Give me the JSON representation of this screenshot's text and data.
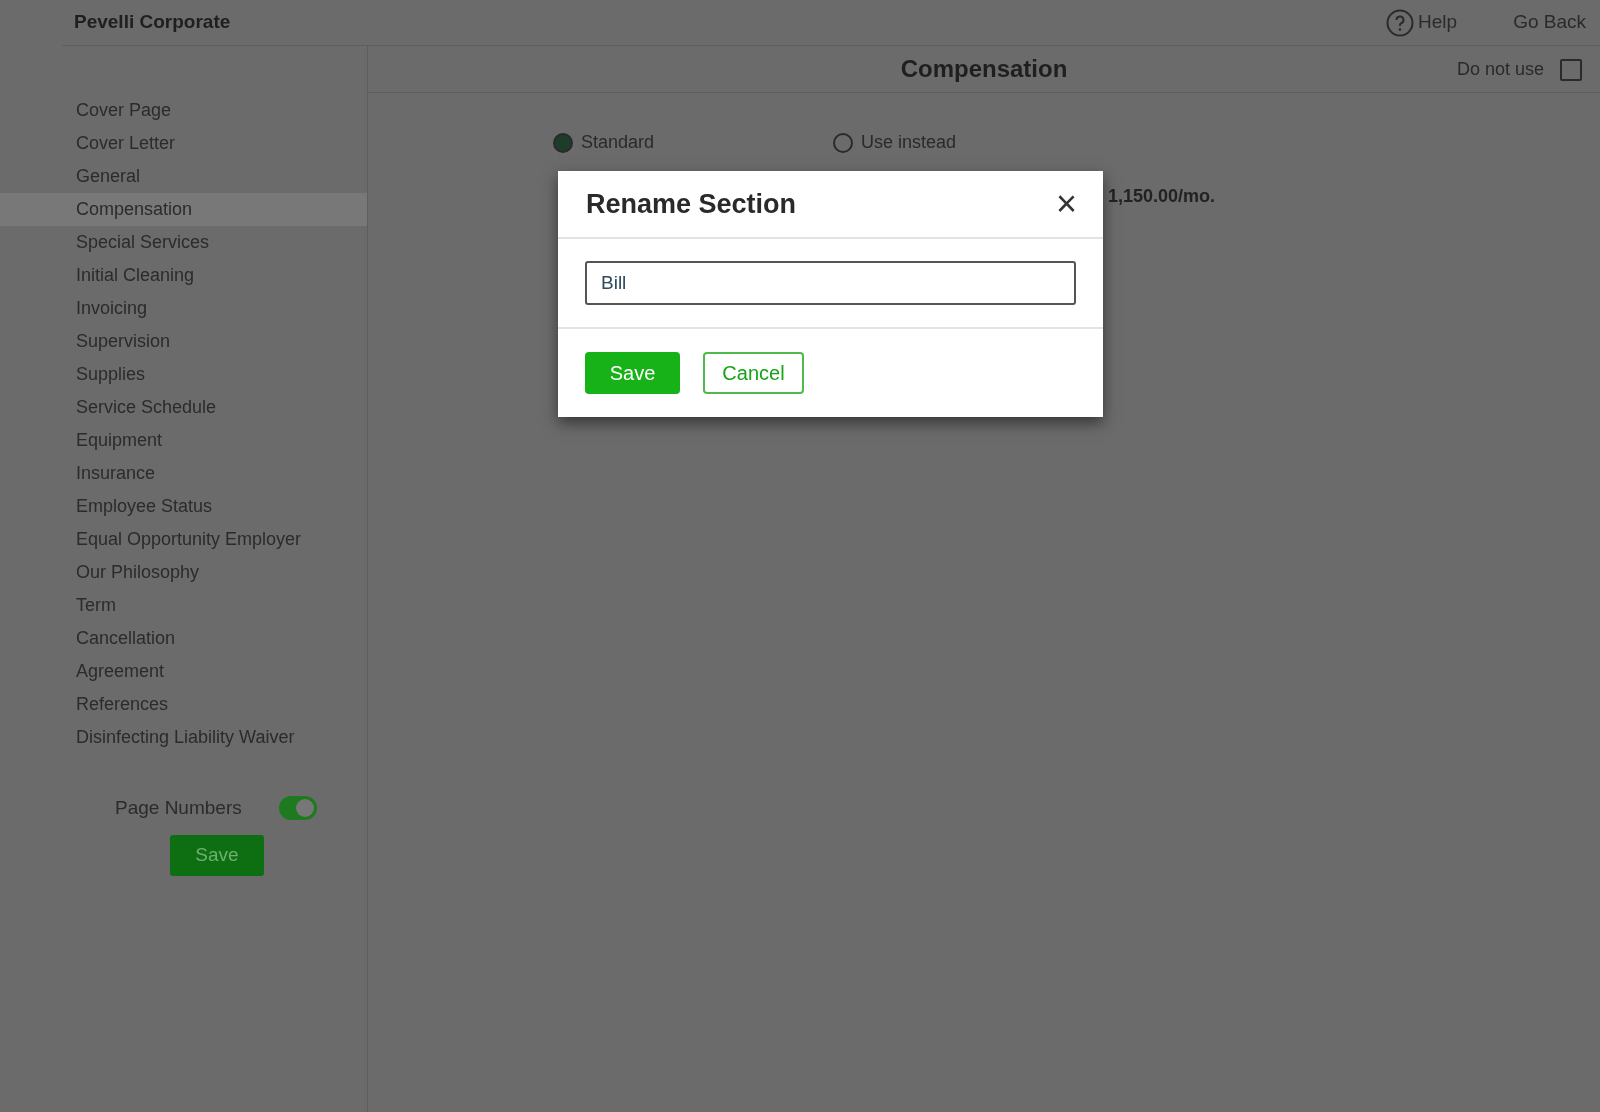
{
  "header": {
    "brand": "Pevelli Corporate",
    "help": "Help",
    "go_back": "Go Back"
  },
  "sidebar": {
    "items": [
      {
        "label": "Cover Page",
        "selected": false
      },
      {
        "label": "Cover Letter",
        "selected": false
      },
      {
        "label": "General",
        "selected": false
      },
      {
        "label": "Compensation",
        "selected": true
      },
      {
        "label": "Special Services",
        "selected": false
      },
      {
        "label": "Initial Cleaning",
        "selected": false
      },
      {
        "label": "Invoicing",
        "selected": false
      },
      {
        "label": "Supervision",
        "selected": false
      },
      {
        "label": "Supplies",
        "selected": false
      },
      {
        "label": "Service Schedule",
        "selected": false
      },
      {
        "label": "Equipment",
        "selected": false
      },
      {
        "label": "Insurance",
        "selected": false
      },
      {
        "label": "Employee Status",
        "selected": false
      },
      {
        "label": "Equal Opportunity Employer",
        "selected": false
      },
      {
        "label": "Our Philosophy",
        "selected": false
      },
      {
        "label": "Term",
        "selected": false
      },
      {
        "label": "Cancellation",
        "selected": false
      },
      {
        "label": "Agreement",
        "selected": false
      },
      {
        "label": "References",
        "selected": false
      },
      {
        "label": "Disinfecting Liability Waiver",
        "selected": false
      }
    ],
    "page_numbers": {
      "label": "Page Numbers",
      "on": true
    },
    "save": "Save"
  },
  "main": {
    "title": "Compensation",
    "do_not_use": {
      "label": "Do not use",
      "checked": false
    },
    "options": [
      {
        "label": "Standard",
        "selected": true
      },
      {
        "label": "Use instead",
        "selected": false
      }
    ],
    "amount": "1,150.00/mo."
  },
  "dialog": {
    "title": "Rename Section",
    "close": "×",
    "value": "Bill",
    "buttons": [
      "Save",
      "Cancel"
    ]
  }
}
